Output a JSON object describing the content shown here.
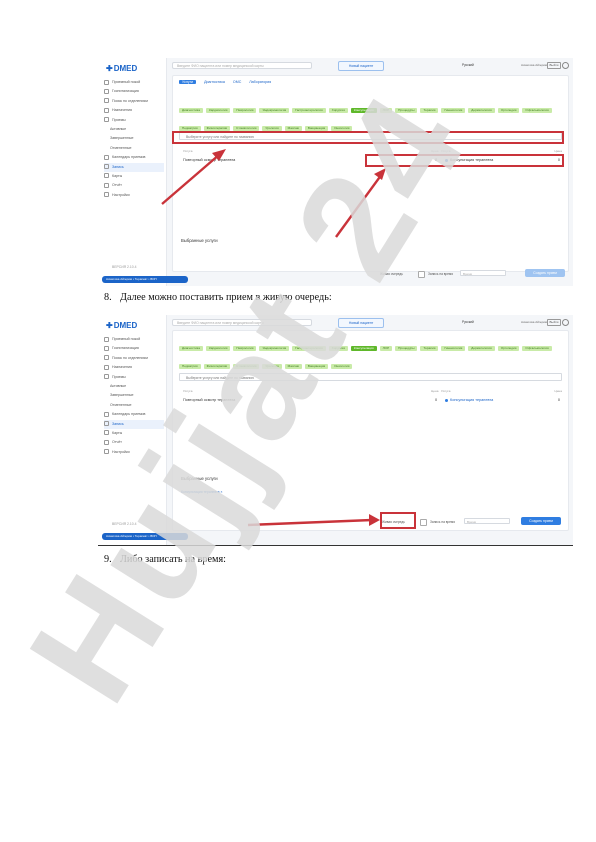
{
  "steps": [
    {
      "number": "8.",
      "text": "Далее можно поставить прием в живую очередь:"
    },
    {
      "number": "9.",
      "text": "Либо записать на время:"
    }
  ],
  "app": {
    "logo": "DMED",
    "search_placeholder": "Введите ФИО пациента или номер медицинской карты",
    "new_patient_button": "Новый пациент",
    "flag_label": "Русский",
    "user_label": "Ахметова Айгерим",
    "user_box": "Выйти",
    "sidebar_items": [
      {
        "label": "Приемный покой",
        "sub": false,
        "active": false
      },
      {
        "label": "Госпитализация",
        "sub": false,
        "active": false
      },
      {
        "label": "Поиск по отделениям",
        "sub": false,
        "active": false
      },
      {
        "label": "Назначения",
        "sub": false,
        "active": false
      },
      {
        "label": "Приемы",
        "sub": false,
        "active": false
      },
      {
        "label": "Активные",
        "sub": true,
        "active": false
      },
      {
        "label": "Завершенные",
        "sub": true,
        "active": false
      },
      {
        "label": "Отмененные",
        "sub": true,
        "active": false
      },
      {
        "label": "Календарь приемов",
        "sub": false,
        "active": false
      },
      {
        "label": "Запись",
        "sub": false,
        "active": true
      },
      {
        "label": "Карты",
        "sub": false,
        "active": false
      },
      {
        "label": "Отчёт",
        "sub": false,
        "active": false
      },
      {
        "label": "Настройки",
        "sub": false,
        "active": false
      }
    ],
    "sidebar_footer": "ВЕРСИЯ 2.10.4",
    "sidebar_chip": "Ахметова Айгерим • Терапевт • ВОП",
    "tabs": [
      {
        "label": "Услуги",
        "active": true
      },
      {
        "label": "Диагностика",
        "active": false
      },
      {
        "label": "ОМС",
        "active": false
      },
      {
        "label": "Лаборатория",
        "active": false
      }
    ],
    "chips": [
      {
        "label": "Диагностика",
        "active": false
      },
      {
        "label": "Кардиология",
        "active": false
      },
      {
        "label": "Неврология",
        "active": false
      },
      {
        "label": "Эндокринология",
        "active": false
      },
      {
        "label": "Гастроэнтерология",
        "active": false
      },
      {
        "label": "Хирургия",
        "active": false
      },
      {
        "label": "Консультация",
        "active": true
      },
      {
        "label": "ЛОР",
        "active": false
      },
      {
        "label": "Процедуры",
        "active": false
      },
      {
        "label": "Терапия",
        "active": false
      },
      {
        "label": "Гинекология",
        "active": false
      },
      {
        "label": "Дерматология",
        "active": false
      },
      {
        "label": "Ортопедия",
        "active": false
      },
      {
        "label": "Офтальмология",
        "active": false
      },
      {
        "label": "Педиатрия",
        "active": false
      },
      {
        "label": "Физиотерапия",
        "active": false
      },
      {
        "label": "Стоматология",
        "active": false
      },
      {
        "label": "Урология",
        "active": false
      },
      {
        "label": "Массаж",
        "active": false
      },
      {
        "label": "Вакцинация",
        "active": false
      },
      {
        "label": "Онкология",
        "active": false
      }
    ],
    "filter_text": "Выберите услугу или найдите по названию",
    "col_service": "Услуга",
    "col_price": "Цена",
    "col_sub": "Услуга",
    "row_left": "Повторный осмотр терапевта",
    "row_left_price": "0",
    "row_right": "Консультация терапевта",
    "row_right_price": "0",
    "selected_title": "Выбранные услуги",
    "selected_link": "Консультация терапевта ×",
    "live_queue": "Живая очередь",
    "hard_label": "Запись на время",
    "time_placeholder": "Время",
    "submit": "Создать прием"
  },
  "watermark": "Hujjat 24",
  "colors": {
    "highlight": "#c9333a",
    "primary": "#2f7de1",
    "chip": "#c9eba8",
    "chip_active": "#5fb82a",
    "watermark": "#d9d9d9",
    "watermark_violet": "#b399ec"
  }
}
